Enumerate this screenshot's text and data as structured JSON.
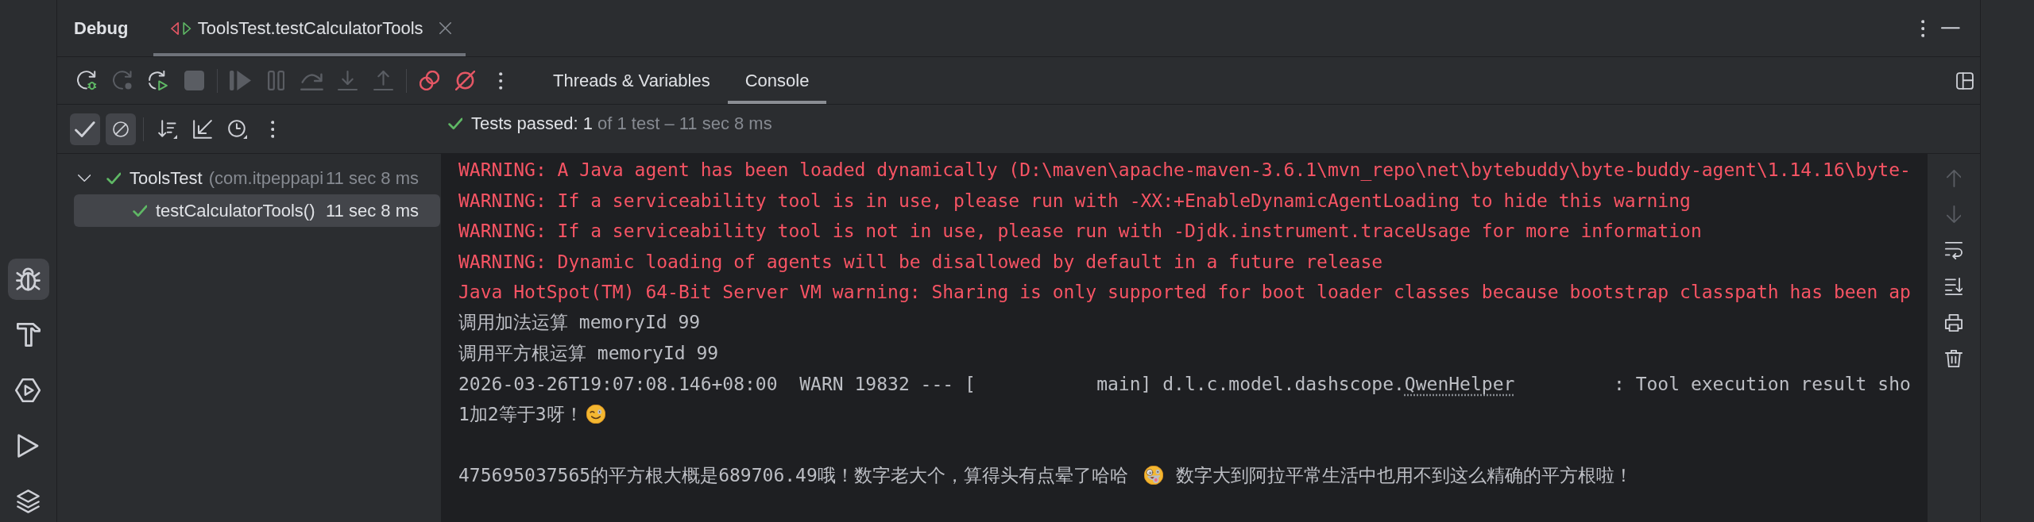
{
  "sidebar": {
    "items": [
      {
        "kind": "debug",
        "selected": true
      },
      {
        "kind": "build",
        "selected": false
      },
      {
        "kind": "services",
        "selected": false
      },
      {
        "kind": "run",
        "selected": false
      },
      {
        "kind": "layers",
        "selected": false
      }
    ]
  },
  "header": {
    "title": "Debug",
    "tabs": [
      {
        "label": "ToolsTest.testCalculatorTools",
        "selected": true
      }
    ]
  },
  "toolbar": {
    "items": [
      {
        "kind": "rerundebug",
        "disabled": false
      },
      {
        "kind": "rerun",
        "disabled": true
      },
      {
        "kind": "rerunfailed",
        "disabled": false
      },
      {
        "kind": "stop",
        "disabled": true
      },
      {
        "kind": "separator"
      },
      {
        "kind": "resume",
        "disabled": true
      },
      {
        "kind": "pause",
        "disabled": true
      },
      {
        "kind": "stepover",
        "disabled": true
      },
      {
        "kind": "stepinto",
        "disabled": true
      },
      {
        "kind": "stepout",
        "disabled": true
      },
      {
        "kind": "separator"
      },
      {
        "kind": "breakpoints",
        "disabled": false
      },
      {
        "kind": "mute",
        "disabled": false
      },
      {
        "kind": "more",
        "disabled": false
      }
    ],
    "tabs": [
      {
        "label": "Threads & Variables",
        "selected": false
      },
      {
        "label": "Console",
        "selected": true
      }
    ]
  },
  "test_tree": {
    "filters": [
      {
        "kind": "passed",
        "selected": true
      },
      {
        "kind": "ignored",
        "selected": true
      }
    ],
    "tools": [
      {
        "kind": "sort"
      },
      {
        "kind": "collapse"
      },
      {
        "kind": "history"
      },
      {
        "kind": "more"
      }
    ],
    "nodes": [
      {
        "label": "ToolsTest",
        "detail": "(com.itpeppapi",
        "time": "11 sec 8 ms",
        "passed": true,
        "expanded": true,
        "selected": false,
        "children": [
          {
            "label": "testCalculatorTools()",
            "time": "11 sec 8 ms",
            "passed": true,
            "selected": true
          }
        ]
      }
    ]
  },
  "status": {
    "summary": "Tests passed: 1",
    "detail": "of 1 test – 11 sec 8 ms",
    "passed": true
  },
  "console": {
    "lines": [
      {
        "kind": "error",
        "parts": [
          {
            "kind": "text",
            "text": "WARNING: A Java agent has been loaded dynamically (D:\\maven\\apache-maven-3.6.1\\mvn_repo\\net\\bytebuddy\\byte-buddy-agent\\1.14.16\\byte-"
          }
        ]
      },
      {
        "kind": "error",
        "parts": [
          {
            "kind": "text",
            "text": "WARNING: If a serviceability tool is in use, please run with -XX:+EnableDynamicAgentLoading to hide this warning"
          }
        ]
      },
      {
        "kind": "error",
        "parts": [
          {
            "kind": "text",
            "text": "WARNING: If a serviceability tool is not in use, please run with -Djdk.instrument.traceUsage for more information"
          }
        ]
      },
      {
        "kind": "error",
        "parts": [
          {
            "kind": "text",
            "text": "WARNING: Dynamic loading of agents will be disallowed by default in a future release"
          }
        ]
      },
      {
        "kind": "error",
        "parts": [
          {
            "kind": "text",
            "text": "Java HotSpot(TM) 64-Bit Server VM warning: Sharing is only supported for boot loader classes because bootstrap classpath has been ap"
          }
        ]
      },
      {
        "kind": "normal",
        "parts": [
          {
            "kind": "text",
            "text": "调用加法运算 memoryId 99"
          }
        ]
      },
      {
        "kind": "normal",
        "parts": [
          {
            "kind": "text",
            "text": "调用平方根运算 memoryId 99"
          }
        ]
      },
      {
        "kind": "normal",
        "parts": [
          {
            "kind": "text",
            "text": "2026-03-26T19:07:08.146+08:00  WARN 19832 --- [           main] d.l.c.model.dashscope."
          },
          {
            "kind": "link",
            "text": "QwenHelper"
          },
          {
            "kind": "text",
            "text": "         : Tool execution result sho"
          }
        ]
      },
      {
        "kind": "normal",
        "parts": [
          {
            "kind": "text",
            "text": "1加2等于3呀！"
          },
          {
            "kind": "wink"
          }
        ]
      },
      {
        "kind": "blank"
      },
      {
        "kind": "normal",
        "parts": [
          {
            "kind": "text",
            "text": "475695037565的平方根大概是689706.49哦！数字老大个，算得头有点晕了哈哈"
          },
          {
            "kind": "zany"
          },
          {
            "kind": "text",
            "text": "数字大到阿拉平常生活中也用不到这么精确的平方根啦！"
          }
        ]
      }
    ],
    "gutter": [
      {
        "kind": "up",
        "disabled": true
      },
      {
        "kind": "down",
        "disabled": true
      },
      {
        "kind": "wrap",
        "disabled": false
      },
      {
        "kind": "end",
        "disabled": false
      },
      {
        "kind": "print",
        "disabled": false
      },
      {
        "kind": "clear",
        "disabled": false
      }
    ]
  }
}
